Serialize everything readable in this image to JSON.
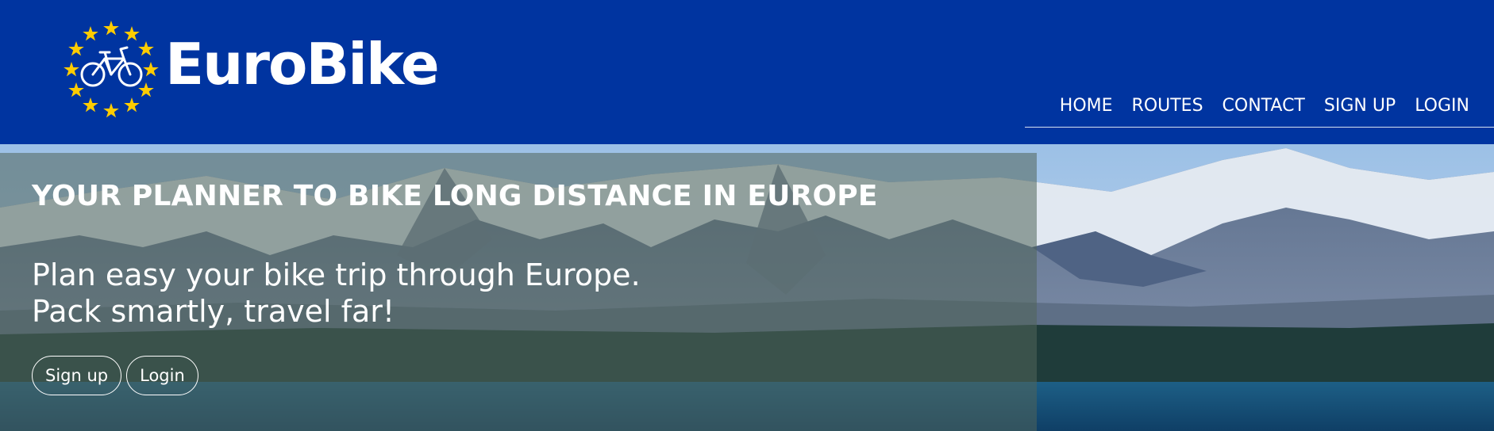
{
  "brand": {
    "name": "EuroBike"
  },
  "icons": {
    "logo": "eu-stars-bicycle-logo"
  },
  "colors": {
    "header_bg": "#0034a0",
    "star": "#ffcc00",
    "text": "#ffffff"
  },
  "nav": {
    "items": [
      {
        "label": "HOME"
      },
      {
        "label": "ROUTES"
      },
      {
        "label": "CONTACT"
      },
      {
        "label": "SIGN UP"
      },
      {
        "label": "LOGIN"
      }
    ]
  },
  "hero": {
    "tagline": "YOUR PLANNER TO BIKE LONG DISTANCE IN EUROPE",
    "lead_line1": "Plan easy your bike trip through Europe.",
    "lead_line2": "Pack smartly, travel far!",
    "signup_label": "Sign up",
    "login_label": "Login"
  }
}
